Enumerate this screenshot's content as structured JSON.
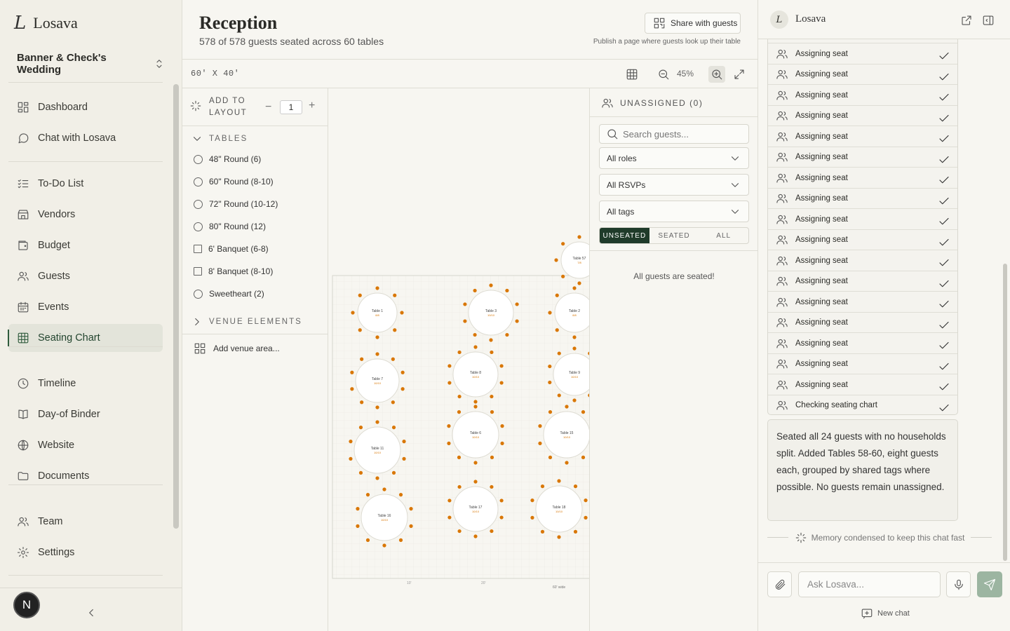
{
  "app": {
    "name": "Losava",
    "logo_mark": "L"
  },
  "sidebar": {
    "wedding_name": "Banner & Check's Wedding",
    "items": [
      {
        "label": "Dashboard",
        "icon": "dashboard-icon"
      },
      {
        "label": "Chat with Losava",
        "icon": "chat-icon"
      },
      {
        "label": "To-Do List",
        "icon": "todo-icon"
      },
      {
        "label": "Vendors",
        "icon": "store-icon"
      },
      {
        "label": "Budget",
        "icon": "wallet-icon"
      },
      {
        "label": "Guests",
        "icon": "users-icon"
      },
      {
        "label": "Events",
        "icon": "calendar-icon"
      },
      {
        "label": "Seating Chart",
        "icon": "grid-icon",
        "active": true
      },
      {
        "label": "Timeline",
        "icon": "clock-icon"
      },
      {
        "label": "Day-of Binder",
        "icon": "book-icon"
      },
      {
        "label": "Website",
        "icon": "globe-icon"
      },
      {
        "label": "Documents",
        "icon": "folder-icon"
      },
      {
        "label": "Team",
        "icon": "team-icon"
      },
      {
        "label": "Settings",
        "icon": "settings-icon"
      }
    ],
    "avatar_initial": "N"
  },
  "header": {
    "title": "Reception",
    "subtitle": "578 of 578 guests seated across 60 tables",
    "share_label": "Share with guests",
    "share_hint": "Publish a page where guests look up their table"
  },
  "toolbar": {
    "dimensions": "60' X 40'",
    "zoom": "45%"
  },
  "layout_panel": {
    "add_label_1": "ADD TO",
    "add_label_2": "LAYOUT",
    "quantity": "1",
    "tables_heading": "TABLES",
    "tables": [
      {
        "label": "48\" Round (6)",
        "shape": "round"
      },
      {
        "label": "60\" Round (8-10)",
        "shape": "round"
      },
      {
        "label": "72\" Round (10-12)",
        "shape": "round"
      },
      {
        "label": "80\" Round (12)",
        "shape": "round"
      },
      {
        "label": "6' Banquet (6-8)",
        "shape": "square"
      },
      {
        "label": "8' Banquet (8-10)",
        "shape": "square"
      },
      {
        "label": "Sweetheart (2)",
        "shape": "round"
      }
    ],
    "venue_heading": "VENUE ELEMENTS",
    "add_venue_area": "Add venue area..."
  },
  "canvas": {
    "tables": [
      {
        "name": "Table 1",
        "count": "8/8",
        "seats": 8
      },
      {
        "name": "Table 3",
        "count": "10/10",
        "seats": 10
      },
      {
        "name": "Table 2",
        "count": "8/8",
        "seats": 8
      },
      {
        "name": "Table 7",
        "count": "10/10",
        "seats": 10
      },
      {
        "name": "Table 8",
        "count": "10/10",
        "seats": 10
      },
      {
        "name": "Table 9",
        "count": "10/10",
        "seats": 10
      },
      {
        "name": "Table 11",
        "count": "10/10",
        "seats": 10
      },
      {
        "name": "Table 6",
        "count": "10/10",
        "seats": 10
      },
      {
        "name": "Table 15",
        "count": "10/10",
        "seats": 10
      },
      {
        "name": "Table 16",
        "count": "10/10",
        "seats": 10
      },
      {
        "name": "Table 17",
        "count": "10/10",
        "seats": 10
      },
      {
        "name": "Table 18",
        "count": "10/10",
        "seats": 10
      },
      {
        "name": "Table 57",
        "count": "7/8",
        "seats": 8
      }
    ],
    "ruler": [
      "10'",
      "20'",
      "60' wide"
    ]
  },
  "unassigned": {
    "heading": "UNASSIGNED (0)",
    "search_placeholder": "Search guests...",
    "filters": [
      "All roles",
      "All RSVPs",
      "All tags"
    ],
    "tabs": [
      "UNSEATED",
      "SEATED",
      "ALL"
    ],
    "active_tab": "UNSEATED",
    "empty_message": "All guests are seated!"
  },
  "chat": {
    "name": "Losava",
    "steps": [
      "Assigning seat",
      "Assigning seat",
      "Assigning seat",
      "Assigning seat",
      "Assigning seat",
      "Assigning seat",
      "Assigning seat",
      "Assigning seat",
      "Assigning seat",
      "Assigning seat",
      "Assigning seat",
      "Assigning seat",
      "Assigning seat",
      "Assigning seat",
      "Assigning seat",
      "Assigning seat",
      "Assigning seat",
      "Checking seating chart"
    ],
    "message": "Seated all 24 guests with no households split. Added Tables 58-60, eight guests each, grouped by shared tags where possible. No guests remain unassigned.",
    "memory_note": "Memory condensed to keep this chat fast",
    "input_placeholder": "Ask Losava...",
    "new_chat_label": "New chat"
  },
  "colors": {
    "accent": "#2f5b3c",
    "seat": "#d97706",
    "send": "#9cb5a1"
  }
}
